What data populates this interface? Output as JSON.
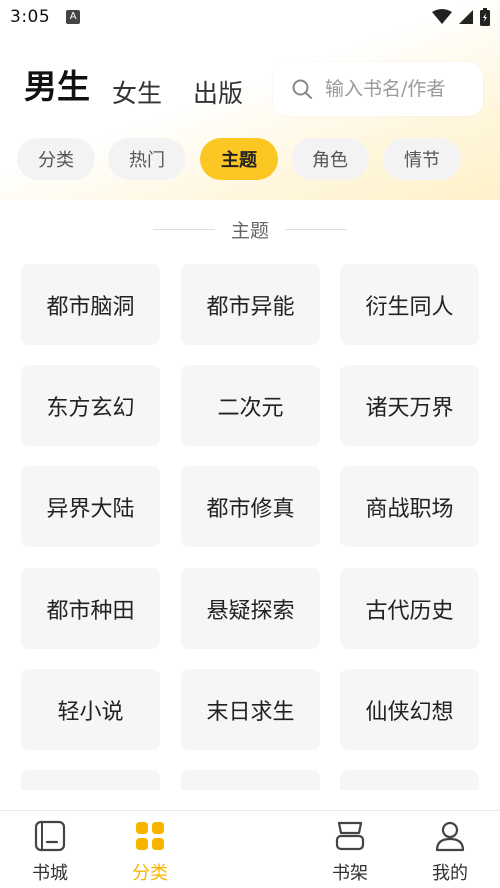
{
  "status_bar": {
    "time": "3:05",
    "notification_icon_letter": "A"
  },
  "top_tabs": [
    "男生",
    "女生",
    "出版"
  ],
  "search": {
    "placeholder": "输入书名/作者"
  },
  "filter_chips": [
    {
      "label": "分类",
      "active": false
    },
    {
      "label": "热门",
      "active": false
    },
    {
      "label": "主题",
      "active": true
    },
    {
      "label": "角色",
      "active": false
    },
    {
      "label": "情节",
      "active": false
    }
  ],
  "section_title": "主题",
  "topics": [
    "都市脑洞",
    "都市异能",
    "衍生同人",
    "东方玄幻",
    "二次元",
    "诸天万界",
    "异界大陆",
    "都市修真",
    "商战职场",
    "都市种田",
    "悬疑探索",
    "古代历史",
    "轻小说",
    "末日求生",
    "仙侠幻想"
  ],
  "bottom_nav": [
    {
      "label": "书城",
      "icon": "bookstore-icon",
      "active": false
    },
    {
      "label": "分类",
      "icon": "category-grid-icon",
      "active": true
    },
    {
      "label": "书架",
      "icon": "bookshelf-icon",
      "active": false
    },
    {
      "label": "我的",
      "icon": "profile-icon",
      "active": false
    }
  ],
  "colors": {
    "accent": "#fcc722",
    "nav_active": "#f7b500",
    "cell_bg": "#f6f6f6",
    "chip_bg": "#f3f3f3"
  }
}
